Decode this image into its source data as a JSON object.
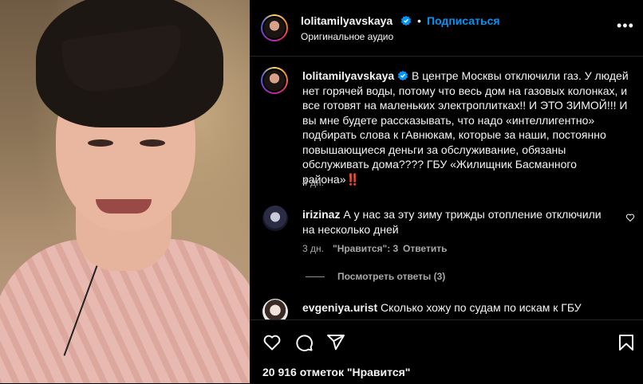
{
  "post": {
    "username": "lolitamilyavskaya",
    "follow_label": "Подписаться",
    "separator": "•",
    "audio": "Оригинальное аудио"
  },
  "caption": {
    "username": "lolitamilyavskaya",
    "text": "В центре Москвы отключили газ. У людей нет горячей воды, потому что весь дом на газовых колонках, и все готовят на маленьких электроплитках!! И ЭТО ЗИМОЙ!!! И вы мне будете рассказывать, что надо «интеллигентно» подбирать слова к гАвнюкам, которые за наши, постоянно повышающиеся деньги за обслуживание, обязаны обслуживать дома???? ГБУ «Жилищник Басманного района»",
    "emoji": "‼️",
    "time": "4 дн."
  },
  "comments": [
    {
      "username": "irizinaz",
      "text": "А у нас за эту зиму трижды отопление отключили на несколько дней",
      "time": "3 дн.",
      "likes": "\"Нравится\": 3",
      "reply": "Ответить",
      "view_replies": "Посмотреть ответы (3)"
    },
    {
      "username": "evgeniya.urist",
      "text": "Сколько хожу по судам по искам к ГБУ"
    }
  ],
  "footer": {
    "likes": "20 916 отметок \"Нравится\""
  },
  "icons": {
    "more": "more-options-icon",
    "verified": "verified-badge-icon",
    "like": "heart-icon",
    "comment": "comment-icon",
    "share": "share-icon",
    "save": "bookmark-icon"
  },
  "colors": {
    "accent": "#0095f6",
    "verified": "#0095f6",
    "secondary_text": "#a8a8a8"
  }
}
